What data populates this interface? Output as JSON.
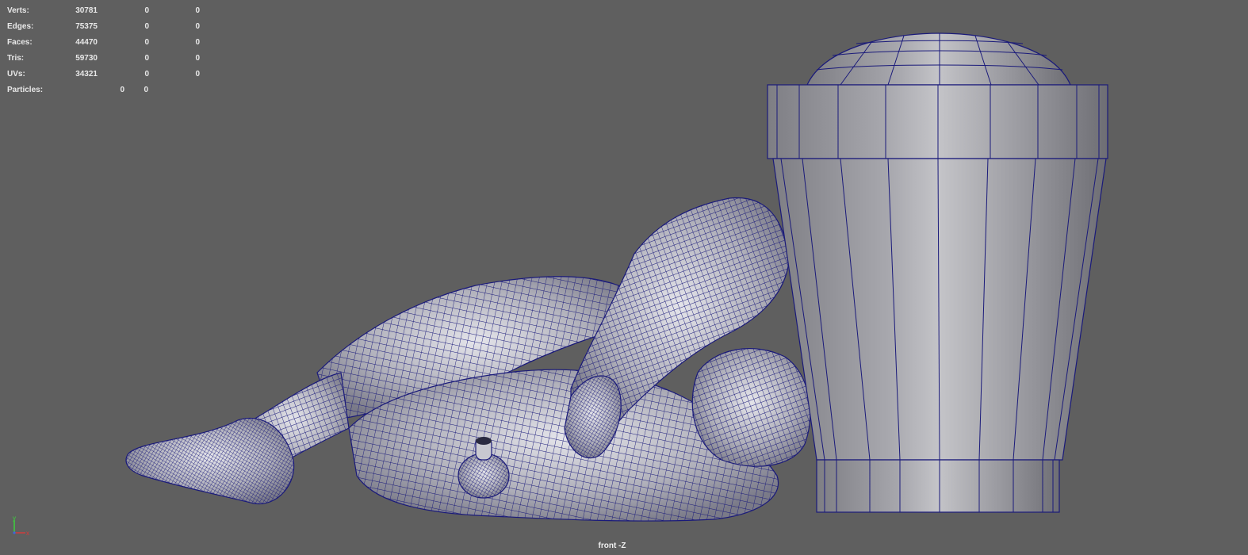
{
  "hud": {
    "rows": [
      {
        "label": "Verts:",
        "v1": "30781",
        "v2": "0",
        "v3": "0"
      },
      {
        "label": "Edges:",
        "v1": "75375",
        "v2": "0",
        "v3": "0"
      },
      {
        "label": "Faces:",
        "v1": "44470",
        "v2": "0",
        "v3": "0"
      },
      {
        "label": "Tris:",
        "v1": "59730",
        "v2": "0",
        "v3": "0"
      },
      {
        "label": "UVs:",
        "v1": "34321",
        "v2": "0",
        "v3": "0"
      }
    ],
    "particles": {
      "label": "Particles:",
      "v1": "0",
      "v2": "0"
    }
  },
  "camera": {
    "label": "front -Z"
  },
  "axis": {
    "x": "x",
    "y": "y"
  },
  "colors": {
    "background": "#5f5f5f",
    "wire": "#1a1a7a",
    "shade": "#b4b4bc",
    "hud_text": "#e8e8e8",
    "axis_x": "#d83a3a",
    "axis_y": "#3ad83a",
    "axis_z": "#3a6ad8"
  }
}
